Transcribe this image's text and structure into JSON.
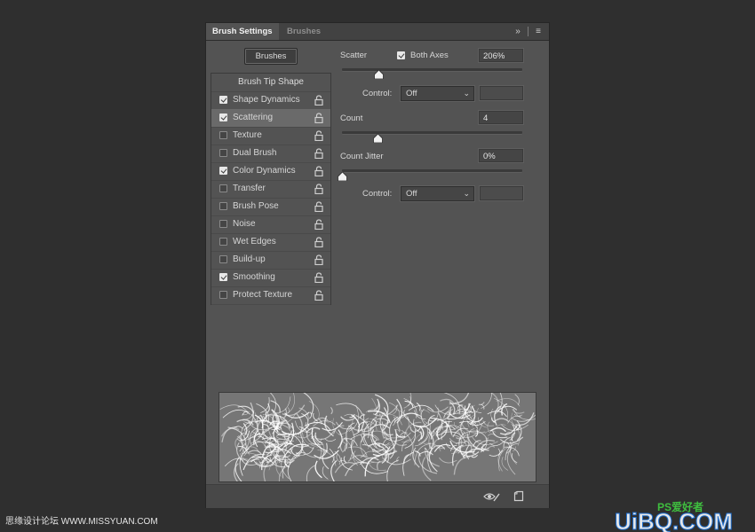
{
  "tabs": {
    "active": "Brush Settings",
    "inactive": "Brushes"
  },
  "toolbar": {
    "expand_icon": "double-chevron-icon",
    "menu_icon": "hamburger-menu-icon"
  },
  "brushes_button": "Brushes",
  "brush_tip_shape": "Brush Tip Shape",
  "items": [
    {
      "label": "Shape Dynamics",
      "checked": true
    },
    {
      "label": "Scattering",
      "checked": true,
      "selected": true
    },
    {
      "label": "Texture",
      "checked": false
    },
    {
      "label": "Dual Brush",
      "checked": false
    },
    {
      "label": "Color Dynamics",
      "checked": true
    },
    {
      "label": "Transfer",
      "checked": false
    },
    {
      "label": "Brush Pose",
      "checked": false
    },
    {
      "label": "Noise",
      "checked": false
    },
    {
      "label": "Wet Edges",
      "checked": false
    },
    {
      "label": "Build-up",
      "checked": false
    },
    {
      "label": "Smoothing",
      "checked": true
    },
    {
      "label": "Protect Texture",
      "checked": false
    }
  ],
  "scatter": {
    "label": "Scatter",
    "both_axes_label": "Both Axes",
    "both_axes_checked": true,
    "value": "206%",
    "slider_fraction": 0.206,
    "control_label": "Control:",
    "control_value": "Off",
    "control_extra": ""
  },
  "count": {
    "label": "Count",
    "value": "4",
    "slider_fraction": 0.2
  },
  "count_jitter": {
    "label": "Count Jitter",
    "value": "0%",
    "slider_fraction": 0,
    "control_label": "Control:",
    "control_value": "Off",
    "control_extra": ""
  },
  "footer": {
    "eye_icon": "visibility-toggle-icon",
    "new_icon": "create-new-preset-icon"
  },
  "watermark": {
    "left": "思缘设计论坛 WWW.MISSYUAN.COM",
    "right_brand": "UiBQ.COM",
    "right_ps": "PS爱好者"
  },
  "colors": {
    "panel": "#535353",
    "tabbar": "#424242",
    "background": "#2f2f2f"
  }
}
